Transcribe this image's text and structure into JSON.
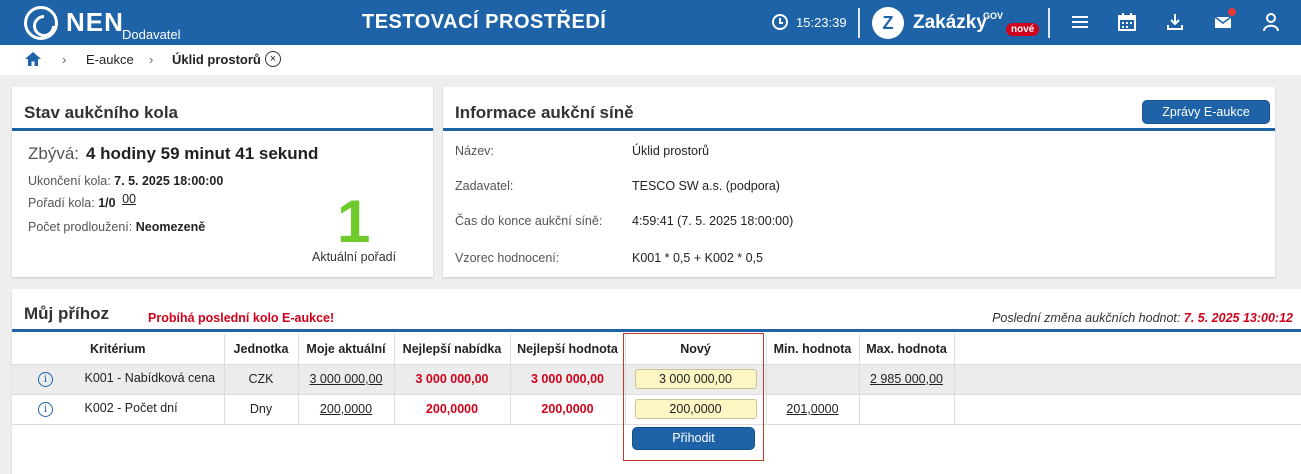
{
  "topbar": {
    "brand": "NEN",
    "brand_sub": "Dodavatel",
    "env_title": "TESTOVACÍ PROSTŘEDÍ",
    "time": "15:23:39",
    "zakazky": "Zakázky",
    "zakazky_gov": "GOV",
    "zakazky_badge": "nové",
    "icons": [
      "menu-icon",
      "calendar-icon",
      "download-icon",
      "mail-icon",
      "user-icon"
    ],
    "accent": "#1e63a8"
  },
  "breadcrumb": {
    "items": [
      "E-aukce",
      "Úklid prostorů"
    ]
  },
  "status_panel": {
    "title": "Stav aukčního kola",
    "remaining_label": "Zbývá:",
    "remaining_value": "4 hodiny 59 minut 41 sekund",
    "end_label": "Ukončení kola:",
    "end_value": "7. 5. 2025 18:00:00",
    "round_label": "Pořadí kola:",
    "round_value": "1/0",
    "round_link": "00",
    "ext_label": "Počet prodloužení:",
    "ext_value": "Neomezeně",
    "rank": "1",
    "rank_label": "Aktuální pořadí"
  },
  "info_panel": {
    "title": "Informace aukční síně",
    "messages_button": "Zprávy E-aukce",
    "rows": [
      {
        "label": "Název:",
        "value": "Úklid prostorů"
      },
      {
        "label": "Zadavatel:",
        "value": "TESCO SW a.s. (podpora)"
      },
      {
        "label": "Čas do konce aukční síně:",
        "value": "4:59:41 (7. 5. 2025 18:00:00)"
      },
      {
        "label": "Vzorec hodnocení:",
        "value": "K001 * 0,5 + K002 * 0,5"
      }
    ]
  },
  "bid_panel": {
    "title": "Můj příhoz",
    "last_round": "Probíhá poslední kolo E-aukce!",
    "last_change_label": "Poslední změna aukčních hodnot:",
    "last_change_value": "7. 5. 2025 13:00:12",
    "columns": [
      "Kritérium",
      "Jednotka",
      "Moje aktuální",
      "Nejlepší nabídka",
      "Nejlepší hodnota",
      "Nový",
      "Min. hodnota",
      "Max. hodnota"
    ],
    "rows": [
      {
        "criterion": "K001 - Nabídková cena",
        "unit": "CZK",
        "mine": "3 000 000,00",
        "best_offer": "3 000 000,00",
        "best_value": "3 000 000,00",
        "new": "3 000 000,00",
        "min": "",
        "max": "2 985 000,00"
      },
      {
        "criterion": "K002 - Počet dní",
        "unit": "Dny",
        "mine": "200,0000",
        "best_offer": "200,0000",
        "best_value": "200,0000",
        "new": "200,0000",
        "min": "201,0000",
        "max": ""
      }
    ],
    "submit_button": "Přihodit"
  }
}
